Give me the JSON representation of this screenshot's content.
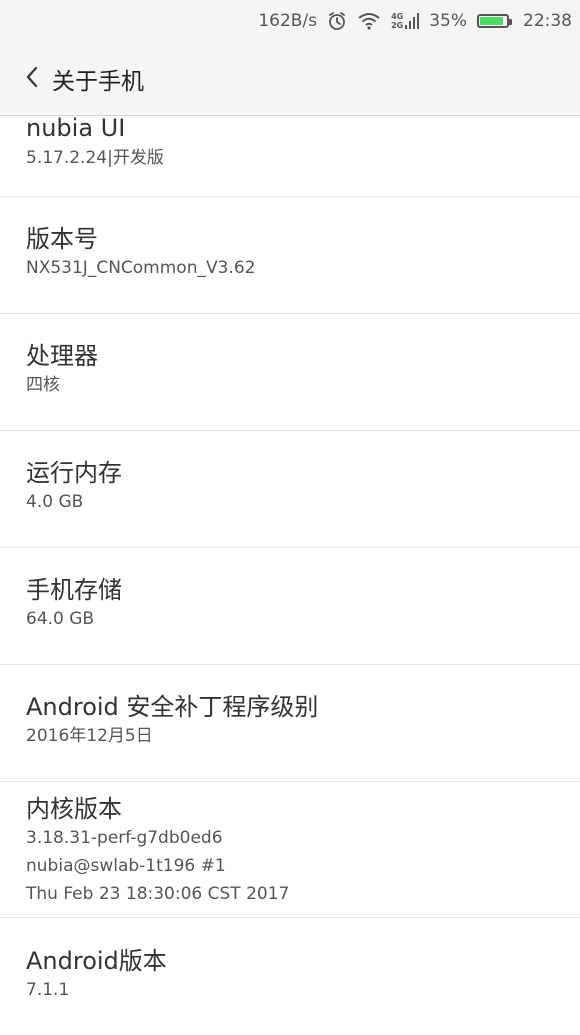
{
  "status_bar": {
    "speed": "162B/s",
    "network_type": [
      "4G",
      "2G"
    ],
    "battery_percent_text": "35%",
    "battery_level": 0.9,
    "time": "22:38",
    "icons": [
      "alarm-icon",
      "wifi-icon",
      "signal-icon",
      "battery-icon"
    ]
  },
  "header": {
    "back_icon": "chevron-left-icon",
    "title": "关于手机"
  },
  "items": [
    {
      "title": "nubia UI",
      "values": [
        "5.17.2.24|开发版"
      ]
    },
    {
      "title": "版本号",
      "values": [
        "NX531J_CNCommon_V3.62"
      ]
    },
    {
      "title": "处理器",
      "values": [
        "四核"
      ]
    },
    {
      "title": "运行内存",
      "values": [
        "4.0 GB"
      ]
    },
    {
      "title": "手机存储",
      "values": [
        "64.0 GB"
      ]
    },
    {
      "title": "Android 安全补丁程序级别",
      "values": [
        "2016年12月5日"
      ]
    },
    {
      "title": "内核版本",
      "values": [
        "3.18.31-perf-g7db0ed6",
        "nubia@swlab-1t196 #1",
        "Thu Feb 23 18:30:06 CST 2017"
      ]
    },
    {
      "title": "Android版本",
      "values": [
        "7.1.1"
      ]
    }
  ],
  "colors": {
    "bar_background": "#f5f5f5",
    "battery_fill": "#4cd964"
  }
}
